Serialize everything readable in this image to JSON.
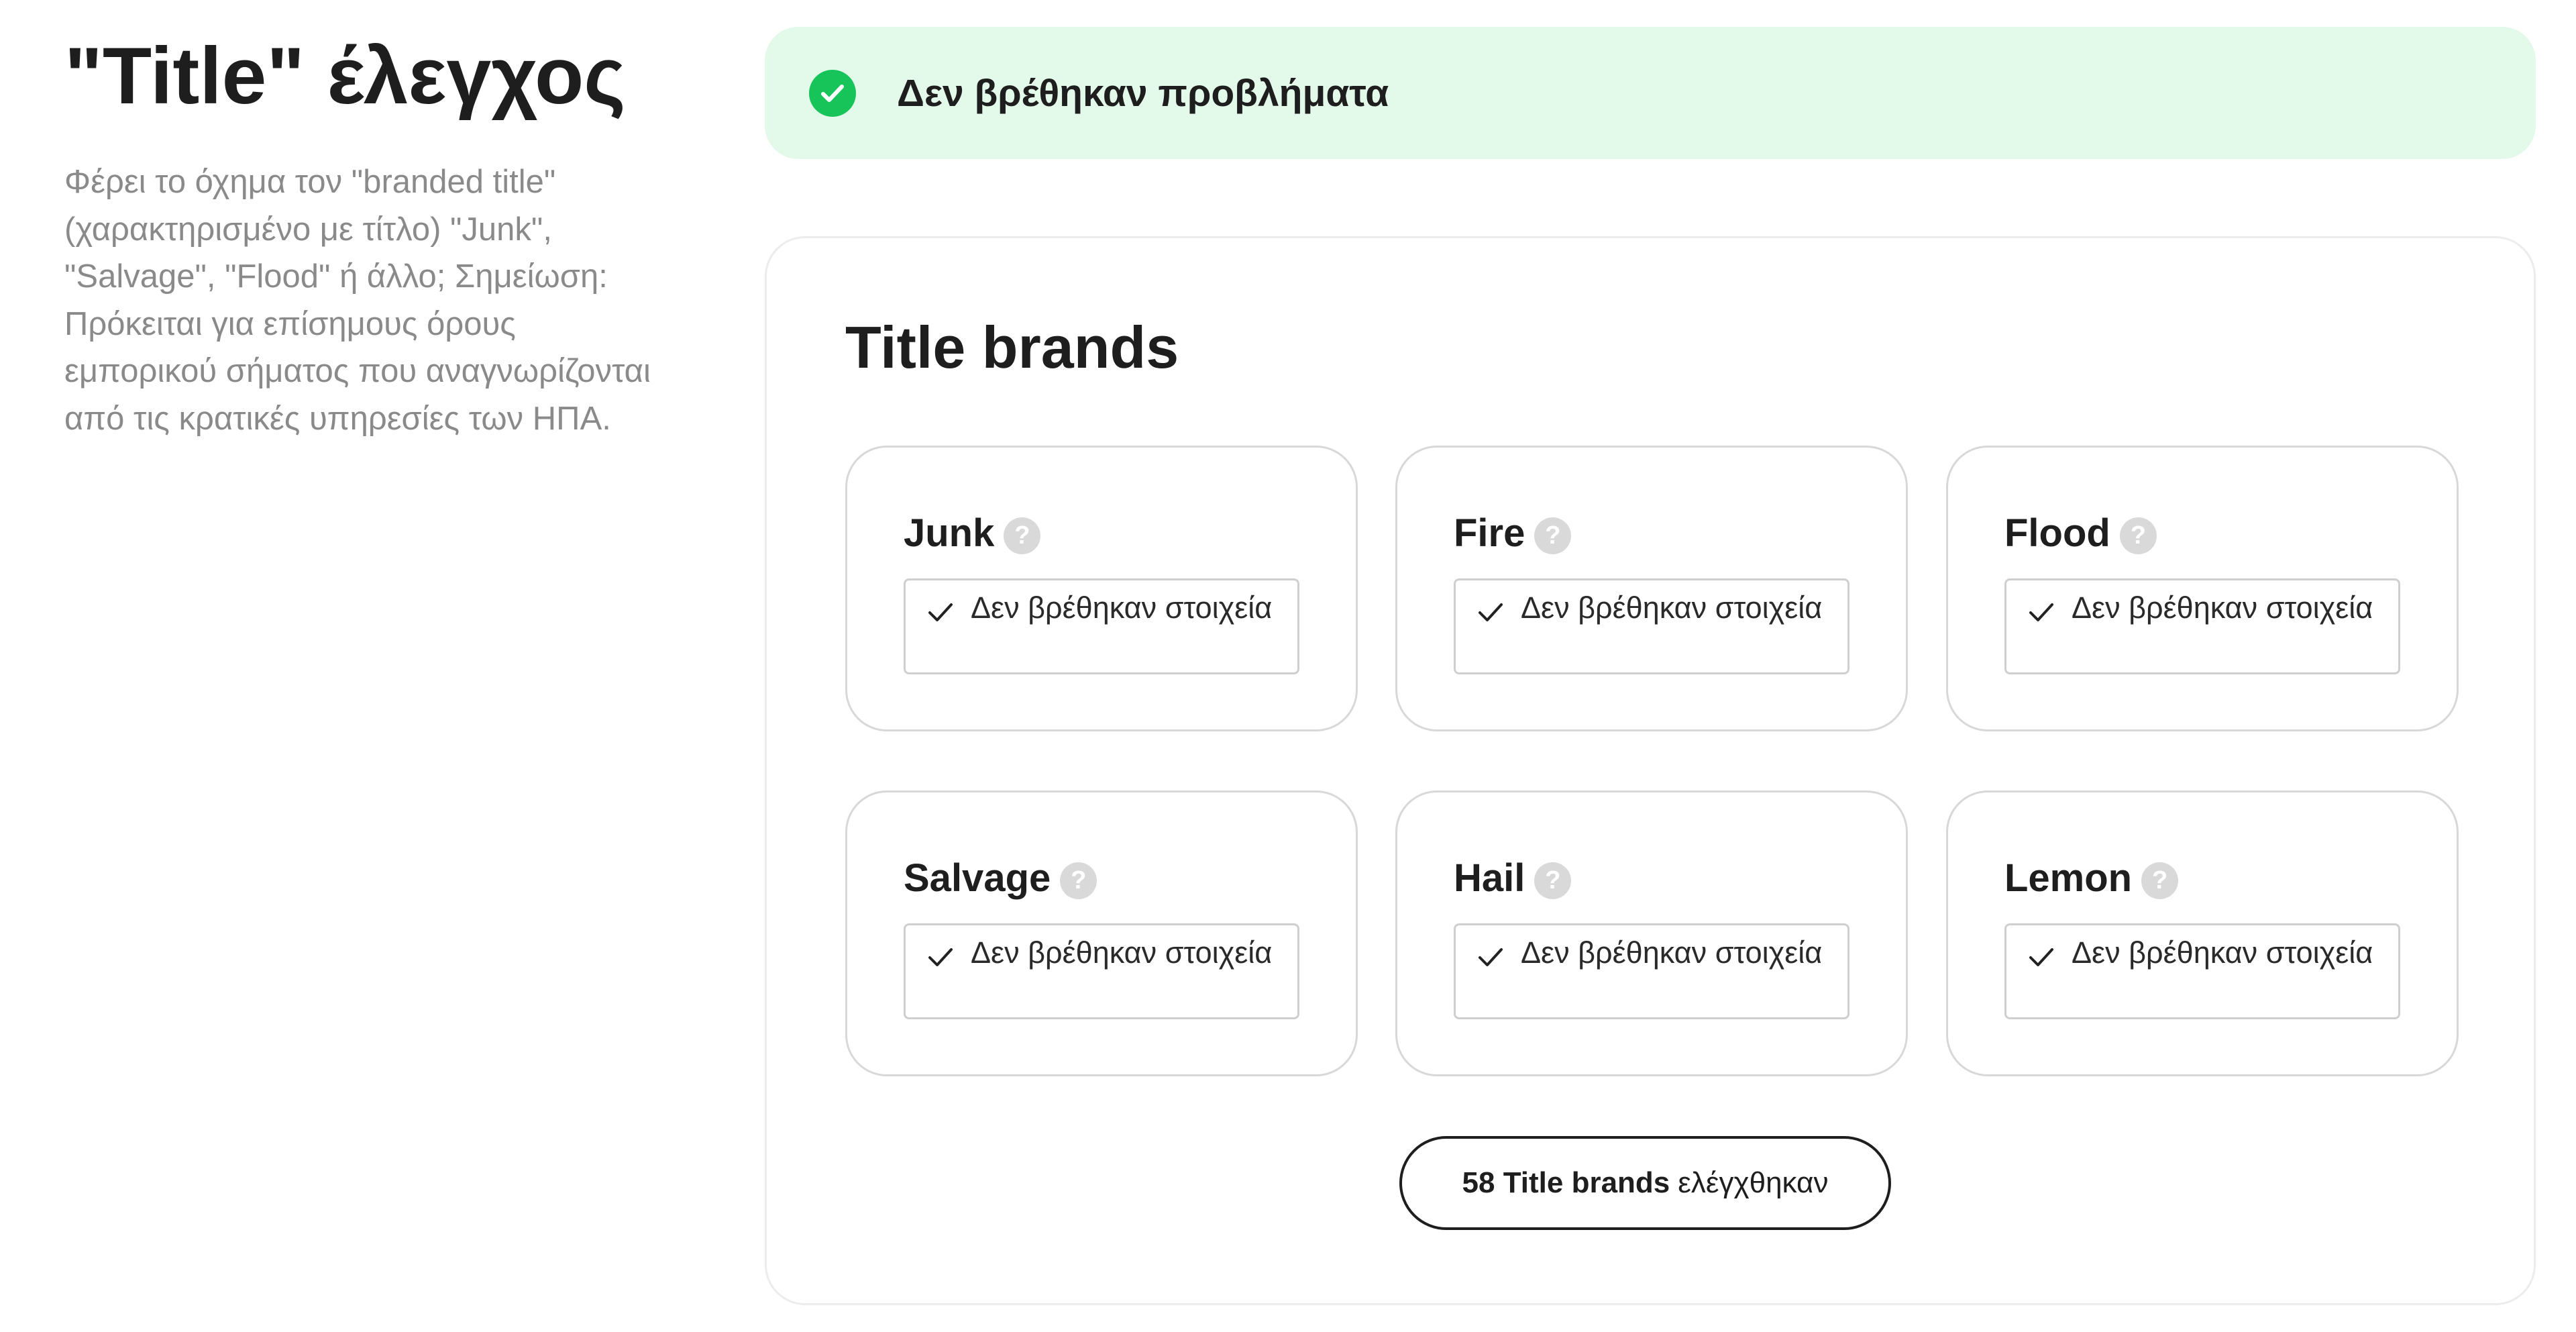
{
  "page": {
    "title": "\"Title\" έλεγχος",
    "description": "Φέρει το όχημα τον \"branded title\" (χαρακτηρισμένο με τίτλο) \"Junk\", \"Salvage\", \"Flood\" ή άλλο; Σημείωση: Πρόκειται για επίσημους όρους εμπορικού σήματος που αναγνωρίζονται από τις κρατικές υπηρεσίες των ΗΠΑ."
  },
  "status": {
    "text": "Δεν βρέθηκαν προβλήματα",
    "icon": "check-circle-icon",
    "color": "#16c45a",
    "background": "#e3faea"
  },
  "panel": {
    "title": "Title brands",
    "cards": [
      {
        "name": "Junk",
        "result": "Δεν βρέθηκαν στοιχεία"
      },
      {
        "name": "Fire",
        "result": "Δεν βρέθηκαν στοιχεία"
      },
      {
        "name": "Flood",
        "result": "Δεν βρέθηκαν στοιχεία"
      },
      {
        "name": "Salvage",
        "result": "Δεν βρέθηκαν στοιχεία"
      },
      {
        "name": "Hail",
        "result": "Δεν βρέθηκαν στοιχεία"
      },
      {
        "name": "Lemon",
        "result": "Δεν βρέθηκαν στοιχεία"
      }
    ],
    "help_glyph": "?",
    "count_button": {
      "strong": "58 Title brands",
      "rest": "ελέγχθηκαν"
    }
  }
}
